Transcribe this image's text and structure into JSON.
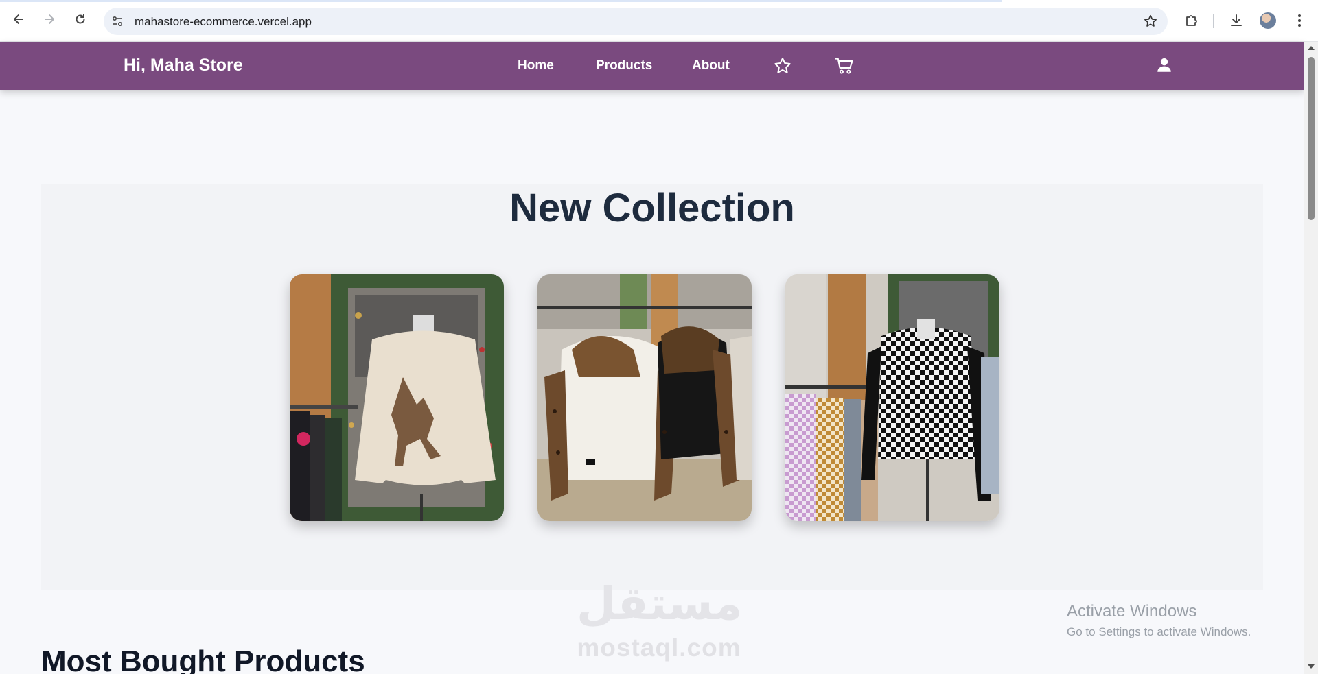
{
  "browser": {
    "url": "mahastore-ecommerce.vercel.app"
  },
  "header": {
    "brand": "Hi, Maha Store",
    "nav": [
      {
        "label": "Home"
      },
      {
        "label": "Products"
      },
      {
        "label": "About"
      }
    ],
    "icons": [
      "star-icon",
      "cart-icon",
      "user-icon"
    ],
    "color": "#7a4a7f"
  },
  "hero": {
    "title": "New Collection",
    "cards": [
      {
        "alt": "deer-sweater-on-mannequin"
      },
      {
        "alt": "leopard-sleeve-sweaters-on-rack"
      },
      {
        "alt": "houndstooth-sweater-on-mannequin"
      }
    ]
  },
  "sections": {
    "most_bought_title": "Most Bought Products"
  },
  "watermark": {
    "logo_text": "مستقل",
    "site": "mostaql.com"
  },
  "os_overlay": {
    "line1": "Activate Windows",
    "line2": "Go to Settings to activate Windows."
  }
}
